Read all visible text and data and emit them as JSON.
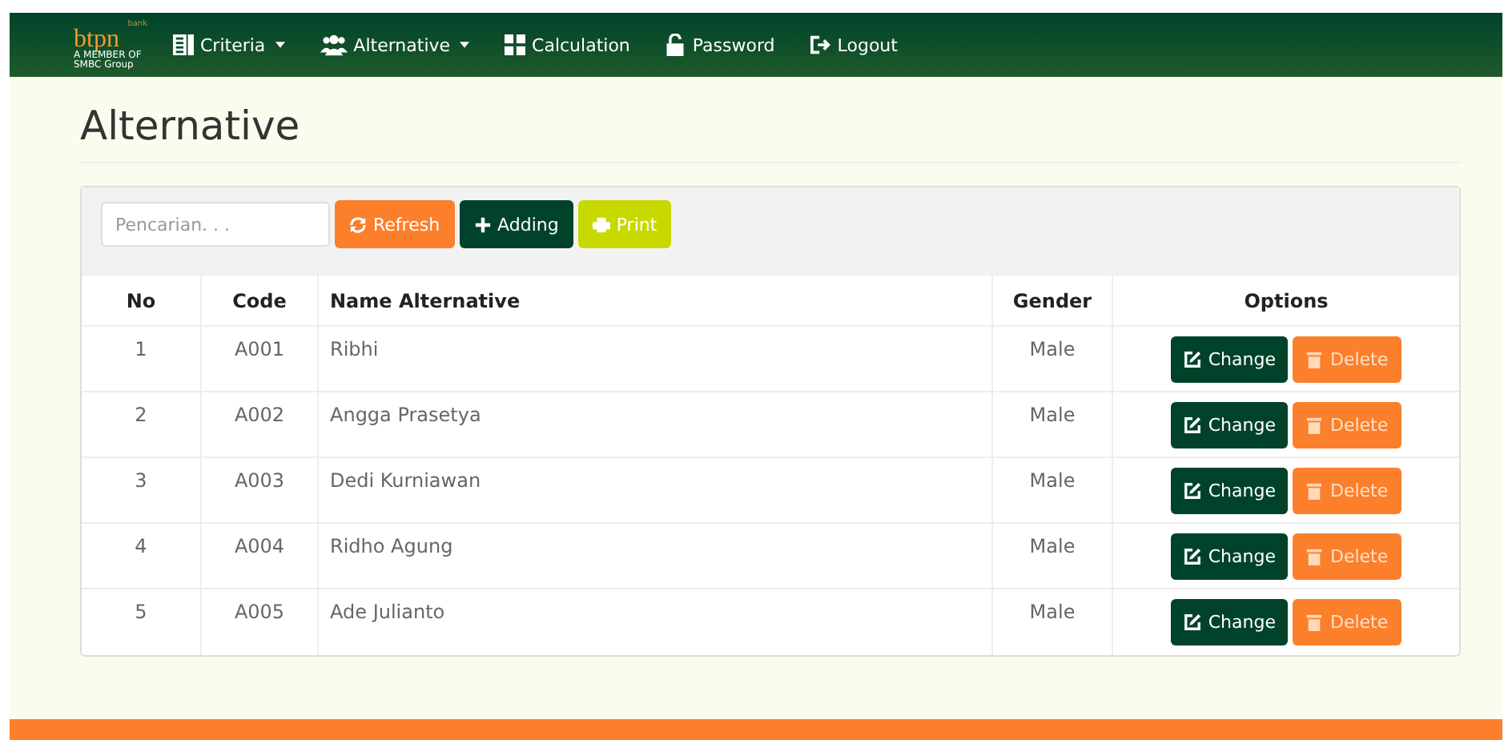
{
  "navbar": {
    "brand": "btpn",
    "brand_small": "bank",
    "tagline": "A MEMBER OF SMBC Group",
    "items": [
      {
        "label": "Criteria",
        "kind": "list",
        "dropdown": true
      },
      {
        "label": "Alternative",
        "kind": "users",
        "dropdown": true
      },
      {
        "label": "Calculation",
        "kind": "calc",
        "dropdown": false
      },
      {
        "label": "Password",
        "kind": "lock",
        "dropdown": false
      },
      {
        "label": "Logout",
        "kind": "logout",
        "dropdown": false
      }
    ]
  },
  "page_title": "Alternative",
  "search": {
    "placeholder": "Pencarian. . ."
  },
  "toolbar": [
    {
      "label": "Refresh",
      "kind": "refresh"
    },
    {
      "label": "Adding",
      "kind": "add"
    },
    {
      "label": "Print",
      "kind": "print"
    }
  ],
  "table": {
    "columns": [
      "No",
      "Code",
      "Name Alternative",
      "Gender",
      "Options"
    ],
    "rows": [
      {
        "no": "1",
        "code": "A001",
        "name": "Ribhi",
        "gender": "Male",
        "actions": [
          "Change",
          "Delete"
        ]
      },
      {
        "no": "2",
        "code": "A002",
        "name": "Angga Prasetya",
        "gender": "Male",
        "actions": [
          "Change",
          "Delete"
        ]
      },
      {
        "no": "3",
        "code": "A003",
        "name": "Dedi Kurniawan",
        "gender": "Male",
        "actions": [
          "Change",
          "Delete"
        ]
      },
      {
        "no": "4",
        "code": "A004",
        "name": "Ridho Agung",
        "gender": "Male",
        "actions": [
          "Change",
          "Delete"
        ]
      },
      {
        "no": "5",
        "code": "A005",
        "name": "Ade Julianto",
        "gender": "Male",
        "actions": [
          "Change",
          "Delete"
        ]
      }
    ]
  }
}
